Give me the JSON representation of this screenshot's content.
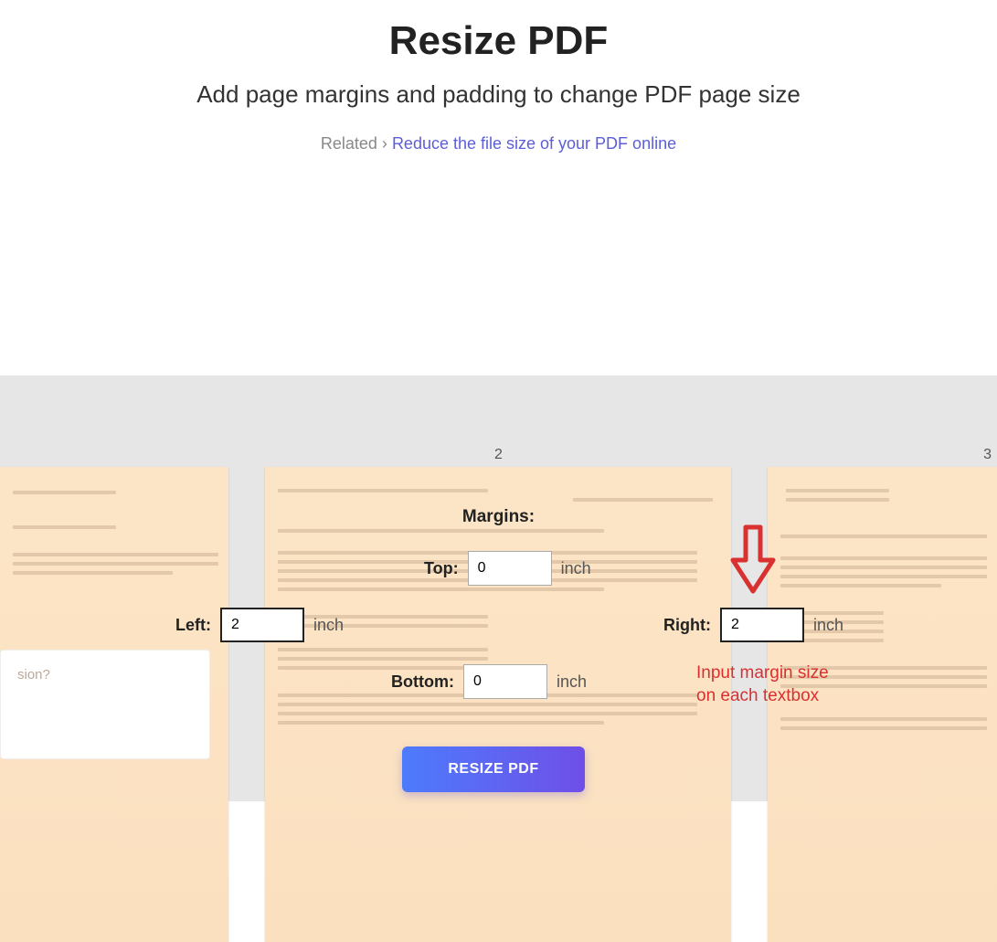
{
  "header": {
    "title": "Resize PDF",
    "subtitle": "Add page margins and padding to change PDF page size",
    "related_prefix": "Related ›",
    "related_link": "Reduce the file size of your PDF online"
  },
  "stage": {
    "page_numbers": {
      "center": "2",
      "right": "3"
    }
  },
  "margins": {
    "heading": "Margins:",
    "top": {
      "label": "Top:",
      "value": "0",
      "unit": "inch"
    },
    "bottom": {
      "label": "Bottom:",
      "value": "0",
      "unit": "inch"
    },
    "left": {
      "label": "Left:",
      "value": "2",
      "unit": "inch"
    },
    "right": {
      "label": "Right:",
      "value": "2",
      "unit": "inch"
    }
  },
  "button": {
    "label": "RESIZE PDF"
  },
  "annotation": {
    "line1": "Input margin size",
    "line2": "on each textbox"
  },
  "left_panel_question": "sion?"
}
